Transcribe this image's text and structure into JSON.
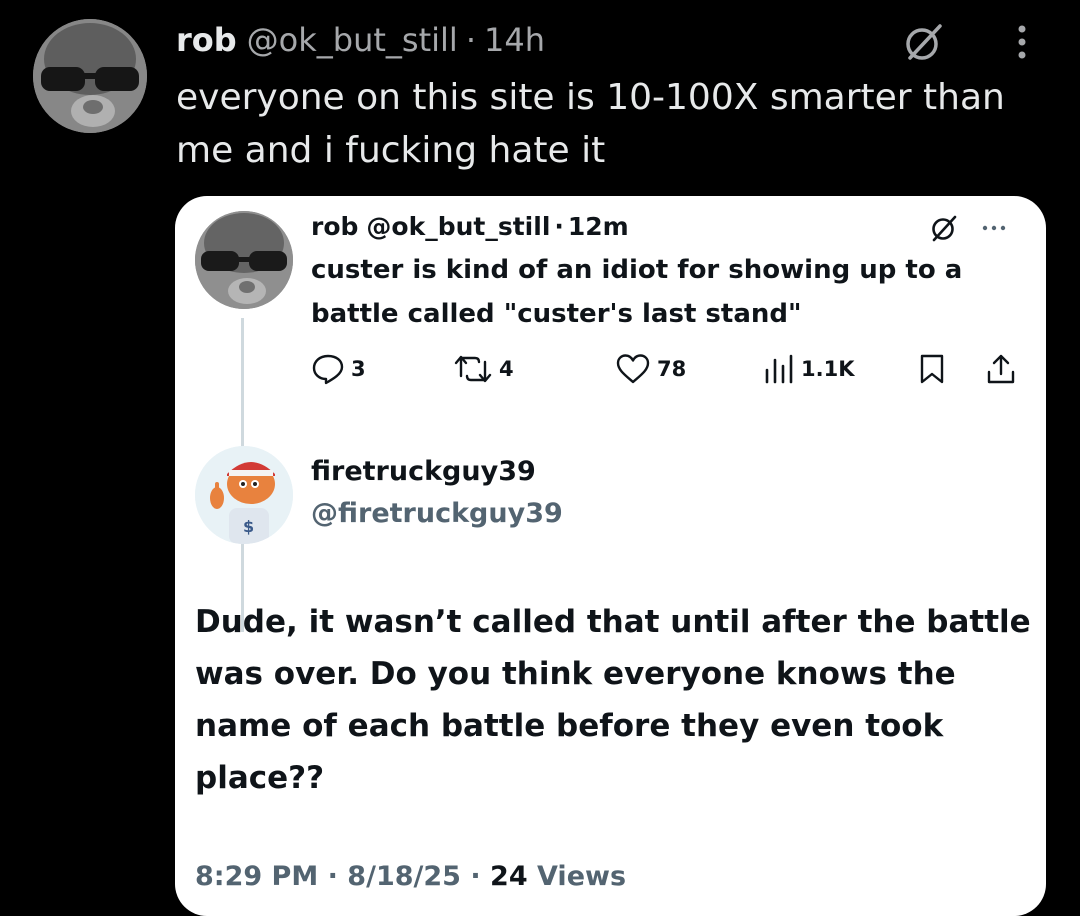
{
  "outer_tweet": {
    "display_name": "rob",
    "handle": "@ok_but_still",
    "separator": "·",
    "time": "14h",
    "text": "everyone on this site is 10-100X smarter than me and i fucking hate it",
    "icons": {
      "grok": "grok-slash-icon",
      "more": "more-vertical-icon"
    }
  },
  "quoted_tweet": {
    "display_name": "rob",
    "handle": "@ok_but_still",
    "separator": "·",
    "time": "12m",
    "text": "custer is kind of an idiot for showing up to a battle called \"custer's last stand\"",
    "actions": {
      "reply_count": "3",
      "repost_count": "4",
      "like_count": "78",
      "view_count": "1.1K"
    },
    "icons": {
      "grok": "grok-slash-icon",
      "more": "more-horizontal-icon",
      "reply": "reply-icon",
      "repost": "repost-icon",
      "like": "heart-icon",
      "views": "views-bar-icon",
      "bookmark": "bookmark-icon",
      "share": "share-icon"
    }
  },
  "reply": {
    "display_name": "firetruckguy39",
    "handle": "@firetruckguy39",
    "text": "Dude, it wasn’t called that until after the battle was over. Do you think everyone knows the name of each battle before they even took place??",
    "time": "8:29 PM",
    "separator1": "·",
    "date": "8/18/25",
    "separator2": "·",
    "views_count": "24",
    "views_label": "Views"
  },
  "colors": {
    "background": "#000000",
    "card": "#ffffff",
    "text_dark": "#0f1419",
    "text_muted": "#536471",
    "text_light": "#e7e9ea",
    "text_light_muted": "#a6a8ab"
  }
}
